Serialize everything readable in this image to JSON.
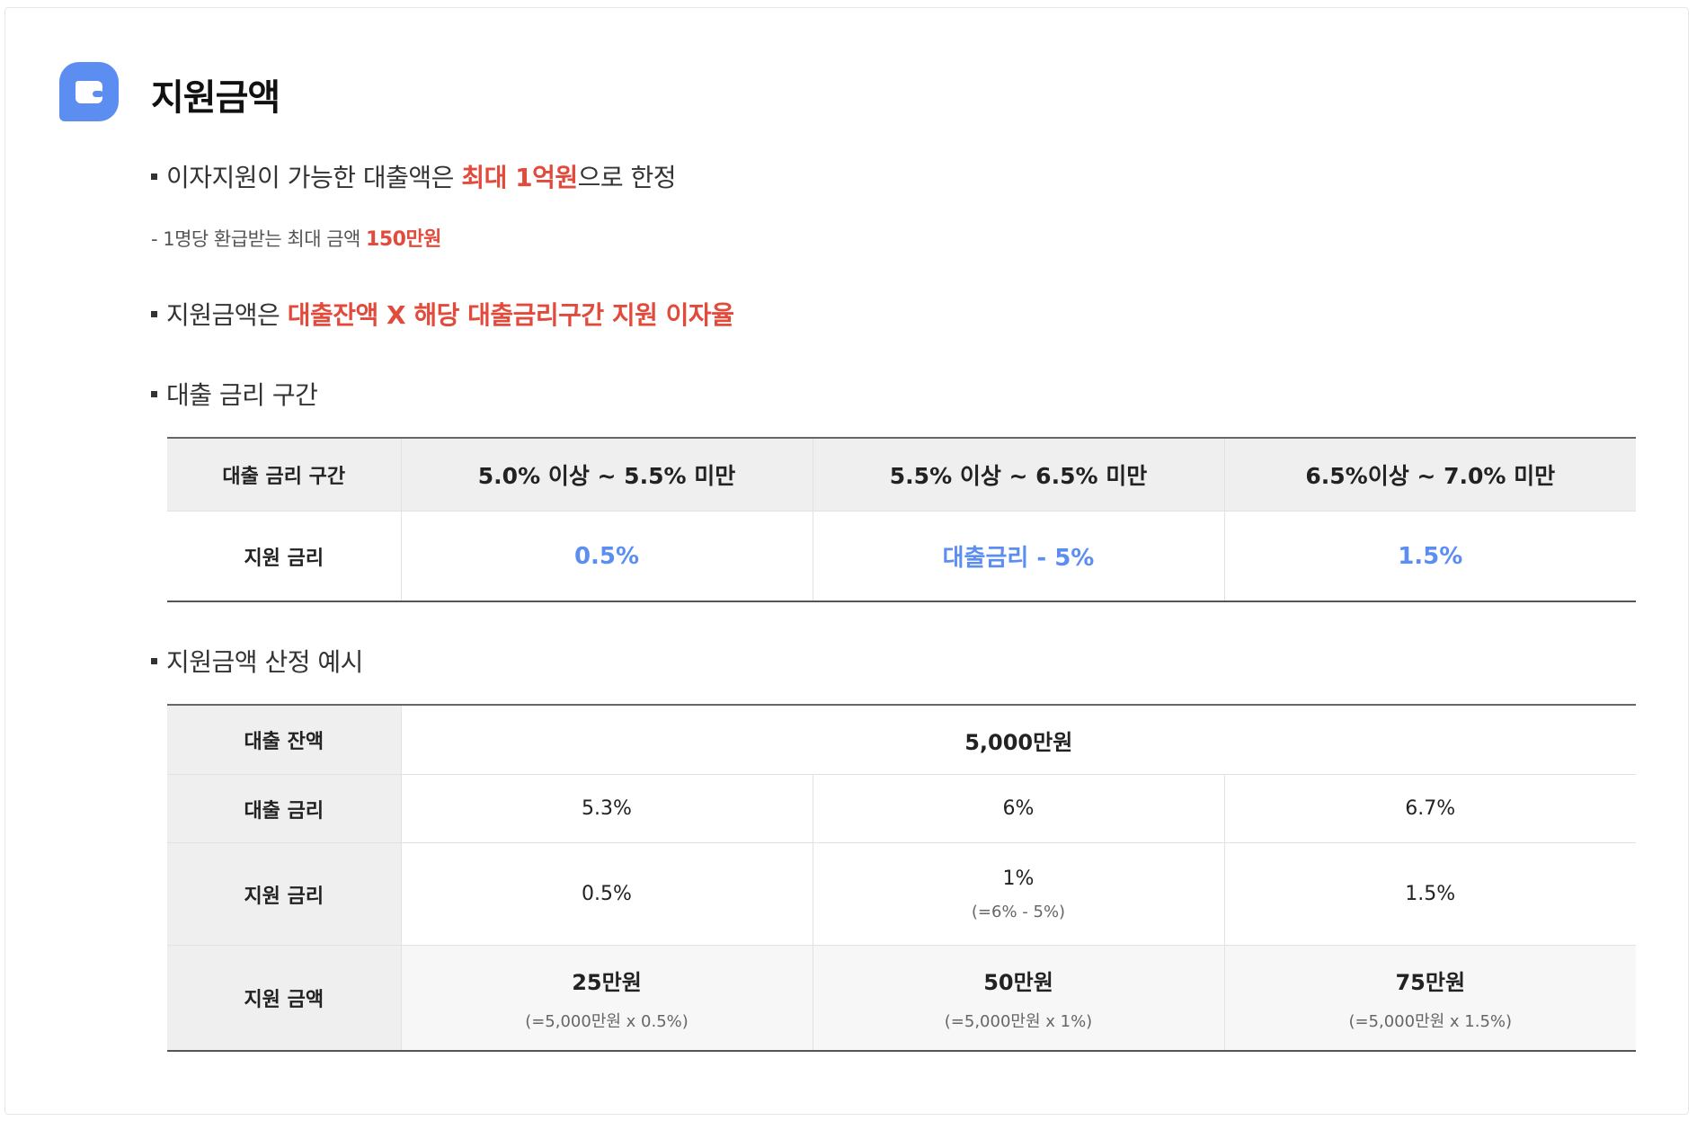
{
  "section": {
    "title": "지원금액"
  },
  "bullets": {
    "b1": {
      "pre": "이자지원이 가능한 대출액은 ",
      "hl": "최대 1억원",
      "post": "으로 한정"
    },
    "sub": {
      "pre": "- 1명당 환급받는 최대 금액 ",
      "hl": "150만원"
    },
    "b2": {
      "pre": "지원금액은 ",
      "hl": "대출잔액 X 해당 대출금리구간 지원 이자율"
    },
    "b3": {
      "text": "대출 금리 구간"
    },
    "b4": {
      "text": "지원금액 산정 예시"
    }
  },
  "rate_table": {
    "header_label": "대출 금리 구간",
    "ranges": [
      "5.0% 이상 ~ 5.5% 미만",
      "5.5% 이상 ~ 6.5% 미만",
      "6.5%이상 ~ 7.0% 미만"
    ],
    "support_label": "지원 금리",
    "support": [
      "0.5%",
      "대출금리 - 5%",
      "1.5%"
    ]
  },
  "example_table": {
    "balance_label": "대출 잔액",
    "balance": "5,000만원",
    "loan_rate_label": "대출 금리",
    "loan_rates": [
      "5.3%",
      "6%",
      "6.7%"
    ],
    "support_rate_label": "지원 금리",
    "support_rates": [
      "0.5%",
      "1%",
      "1.5%"
    ],
    "support_rate_note": "(=6% - 5%)",
    "amount_label": "지원 금액",
    "amounts": [
      "25만원",
      "50만원",
      "75만원"
    ],
    "amount_notes": [
      "(=5,000만원 x 0.5%)",
      "(=5,000만원 x 1%)",
      "(=5,000만원 x 1.5%)"
    ]
  },
  "icons": {
    "header": "wallet-icon"
  },
  "colors": {
    "accent": "#5b8ef0",
    "highlight": "#e24a3b"
  }
}
